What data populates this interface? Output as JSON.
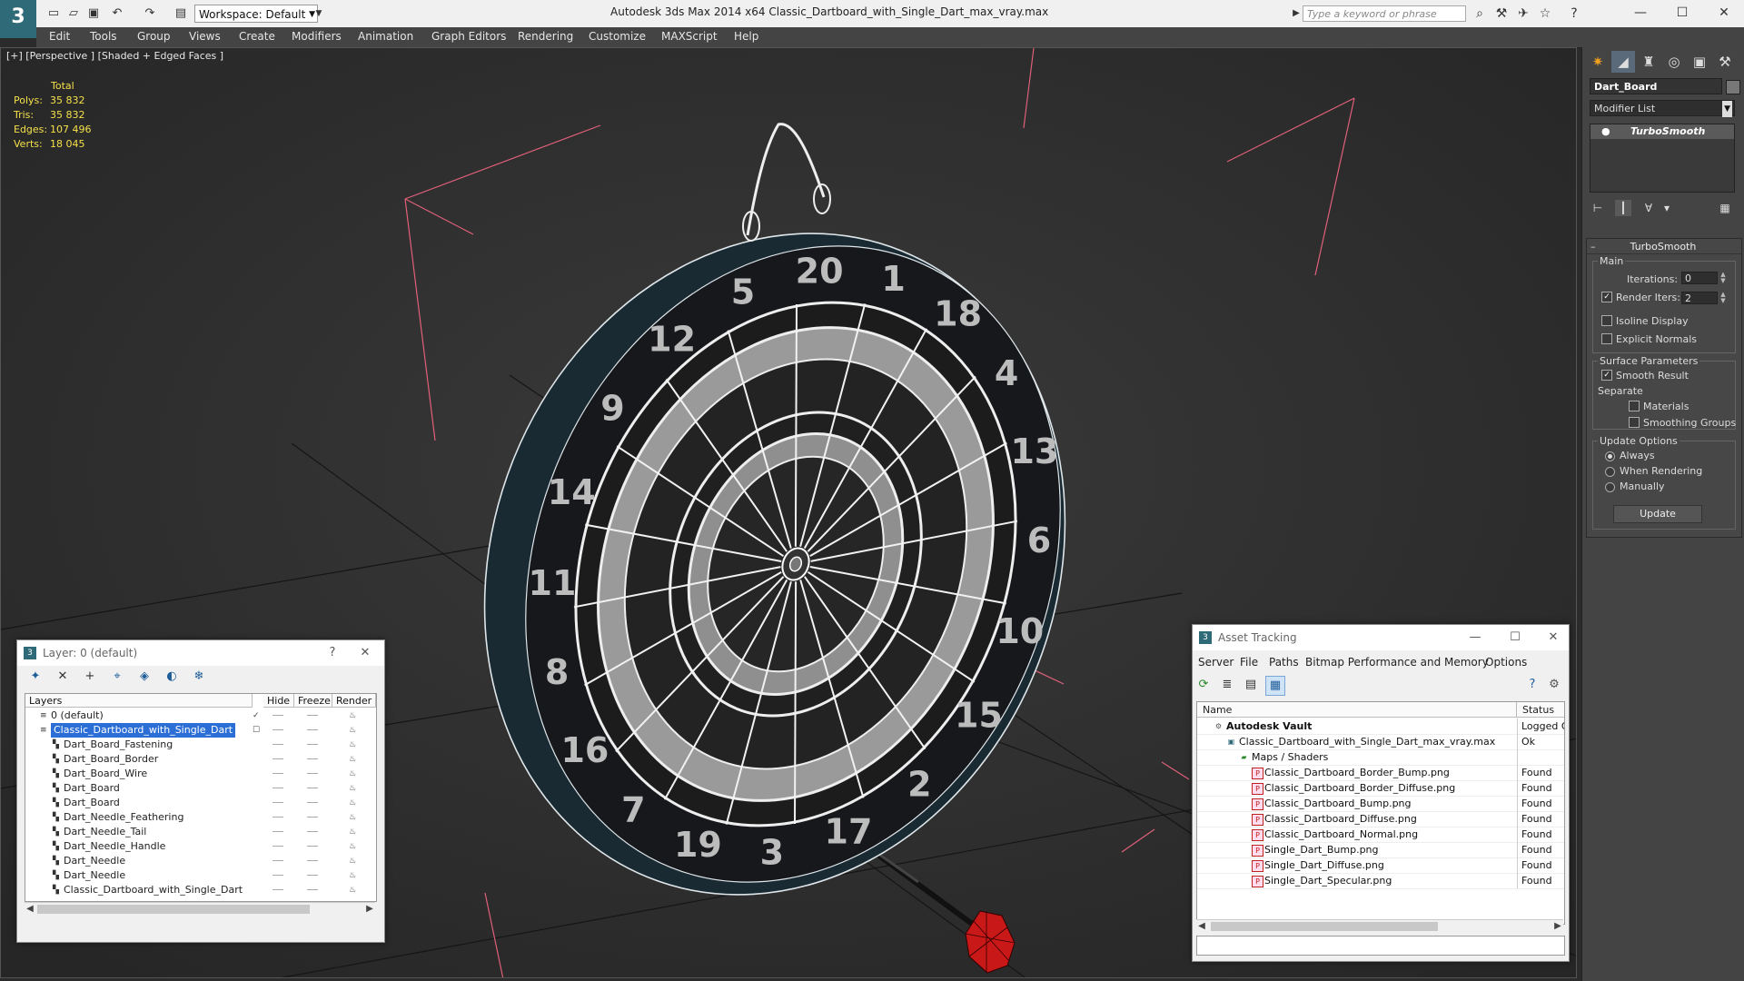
{
  "titlebar": {
    "title": "Autodesk 3ds Max  2014 x64        Classic_Dartboard_with_Single_Dart_max_vray.max",
    "workspace": "Workspace: Default",
    "search_placeholder": "Type a keyword or phrase"
  },
  "menu": [
    "Edit",
    "Tools",
    "Group",
    "Views",
    "Create",
    "Modifiers",
    "Animation",
    "Graph Editors",
    "Rendering",
    "Customize",
    "MAXScript",
    "Help"
  ],
  "viewport": {
    "label": "[+] [Perspective ] [Shaded + Edged Faces ]",
    "stats": {
      "header": "Total",
      "rows": [
        {
          "key": "Polys:",
          "value": "35 832"
        },
        {
          "key": "Tris:",
          "value": "35 832"
        },
        {
          "key": "Edges:",
          "value": "107 496"
        },
        {
          "key": "Verts:",
          "value": "18 045"
        }
      ]
    },
    "board_numbers": [
      "20",
      "1",
      "18",
      "4",
      "13",
      "6",
      "10",
      "15",
      "2",
      "17",
      "3",
      "19",
      "7",
      "16",
      "8",
      "11",
      "14",
      "9",
      "12",
      "5"
    ]
  },
  "command_panel": {
    "object_name": "Dart_Board",
    "modifier_list": "Modifier List",
    "stack_item": "TurboSmooth",
    "rollout_title": "TurboSmooth",
    "main_label": "Main",
    "iterations_label": "Iterations:",
    "iterations_value": "0",
    "render_iters_label": "Render Iters:",
    "render_iters_value": "2",
    "isoline_label": "Isoline Display",
    "explicit_label": "Explicit Normals",
    "surface_label": "Surface Parameters",
    "smooth_label": "Smooth Result",
    "separate_label": "Separate",
    "materials_label": "Materials",
    "smoothing_groups_label": "Smoothing Groups",
    "update_options_label": "Update Options",
    "always_label": "Always",
    "when_rendering_label": "When Rendering",
    "manually_label": "Manually",
    "update_button": "Update"
  },
  "layer_dialog": {
    "title": "Layer: 0 (default)",
    "help": "?",
    "columns": [
      "Layers",
      "Hide",
      "Freeze",
      "Render"
    ],
    "rows": [
      {
        "name": "0 (default)",
        "indent": 1,
        "selected": false,
        "check": "✓"
      },
      {
        "name": "Classic_Dartboard_with_Single_Dart",
        "indent": 1,
        "selected": true,
        "check": "☐"
      },
      {
        "name": "Dart_Board_Fastening",
        "indent": 2,
        "selected": false,
        "check": ""
      },
      {
        "name": "Dart_Board_Border",
        "indent": 2,
        "selected": false,
        "check": ""
      },
      {
        "name": "Dart_Board_Wire",
        "indent": 2,
        "selected": false,
        "check": ""
      },
      {
        "name": "Dart_Board",
        "indent": 2,
        "selected": false,
        "check": ""
      },
      {
        "name": "Dart_Board",
        "indent": 2,
        "selected": false,
        "check": ""
      },
      {
        "name": "Dart_Needle_Feathering",
        "indent": 2,
        "selected": false,
        "check": ""
      },
      {
        "name": "Dart_Needle_Tail",
        "indent": 2,
        "selected": false,
        "check": ""
      },
      {
        "name": "Dart_Needle_Handle",
        "indent": 2,
        "selected": false,
        "check": ""
      },
      {
        "name": "Dart_Needle",
        "indent": 2,
        "selected": false,
        "check": ""
      },
      {
        "name": "Dart_Needle",
        "indent": 2,
        "selected": false,
        "check": ""
      },
      {
        "name": "Classic_Dartboard_with_Single_Dart",
        "indent": 2,
        "selected": false,
        "check": ""
      }
    ]
  },
  "asset_dialog": {
    "title": "Asset Tracking",
    "menu": [
      "Server",
      "File",
      "Paths",
      "Bitmap Performance and Memory",
      "Options"
    ],
    "columns": [
      "Name",
      "Status"
    ],
    "rows": [
      {
        "name": "Autodesk Vault",
        "status": "Logged O",
        "indent": 0,
        "kind": "vault"
      },
      {
        "name": "Classic_Dartboard_with_Single_Dart_max_vray.max",
        "status": "Ok",
        "indent": 1,
        "kind": "max"
      },
      {
        "name": "Maps / Shaders",
        "status": "",
        "indent": 2,
        "kind": "folder"
      },
      {
        "name": "Classic_Dartboard_Border_Bump.png",
        "status": "Found",
        "indent": 3,
        "kind": "png"
      },
      {
        "name": "Classic_Dartboard_Border_Diffuse.png",
        "status": "Found",
        "indent": 3,
        "kind": "png"
      },
      {
        "name": "Classic_Dartboard_Bump.png",
        "status": "Found",
        "indent": 3,
        "kind": "png"
      },
      {
        "name": "Classic_Dartboard_Diffuse.png",
        "status": "Found",
        "indent": 3,
        "kind": "png"
      },
      {
        "name": "Classic_Dartboard_Normal.png",
        "status": "Found",
        "indent": 3,
        "kind": "png"
      },
      {
        "name": "Single_Dart_Bump.png",
        "status": "Found",
        "indent": 3,
        "kind": "png"
      },
      {
        "name": "Single_Dart_Diffuse.png",
        "status": "Found",
        "indent": 3,
        "kind": "png"
      },
      {
        "name": "Single_Dart_Specular.png",
        "status": "Found",
        "indent": 3,
        "kind": "png"
      }
    ]
  },
  "colors": {
    "stats_text": "#f4e04a",
    "selection": "#2b6fd6",
    "bbox_lines": "#e0607a",
    "dart_red": "#d01818"
  }
}
